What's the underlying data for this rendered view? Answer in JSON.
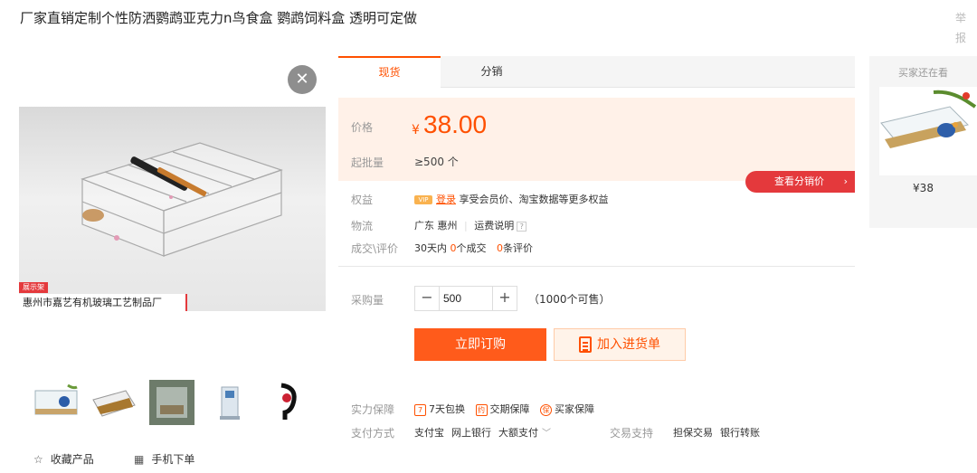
{
  "header": {
    "title": "厂家直销定制个性防洒鹦鹉亚克力n鸟食盒 鹦鹉饲料盒 透明可定做",
    "report": "举报"
  },
  "gallery": {
    "close_icon": "close-icon",
    "shop_tag_label": "展示架",
    "shop_name": "惠州市嘉艺有机玻璃工艺制品厂",
    "thumbnails": [
      "bird-feeder-photo",
      "feeder-with-seeds-photo",
      "feeder-closeup-photo",
      "small-feeder-photo",
      "bracket-photo"
    ],
    "favorite_label": "收藏产品",
    "mobile_order_label": "手机下单"
  },
  "tabs": [
    "现货",
    "分销"
  ],
  "price_panel": {
    "price_label": "价格",
    "currency": "¥",
    "price": "38.00",
    "moq_label": "起批量",
    "moq_value": "≥500 个",
    "distributor_price_button": "查看分销价",
    "chevron": "›"
  },
  "rights": {
    "label": "权益",
    "vip_badge": "VIP",
    "login_link": "登录",
    "text": "享受会员价、淘宝数据等更多权益"
  },
  "logistics": {
    "label": "物流",
    "origin": "广东 惠州",
    "freight_link": "运费说明",
    "help": "?"
  },
  "deals": {
    "label": "成交\\评价",
    "prefix": "30天内",
    "deal_count": "0",
    "deal_suffix": "个成交",
    "review_count": "0",
    "review_suffix": "条评价"
  },
  "quantity": {
    "label": "采购量",
    "minus": "−",
    "value": "500",
    "plus": "+",
    "available": "（1000个可售）"
  },
  "actions": {
    "order_now": "立即订购",
    "add_to_list": "加入进货单"
  },
  "guarantee": {
    "label": "实力保障",
    "items": [
      {
        "icon": "7",
        "text": "7天包换"
      },
      {
        "icon": "约",
        "text": "交期保障"
      },
      {
        "icon": "保",
        "text": "买家保障"
      }
    ]
  },
  "payment": {
    "label": "支付方式",
    "methods": [
      "支付宝",
      "网上银行",
      "大额支付"
    ],
    "dropdown": "﹀",
    "trade_label": "交易支持",
    "trade_methods": [
      "担保交易",
      "银行转账"
    ]
  },
  "rail": {
    "title": "买家还在看",
    "price": "¥38"
  },
  "colors": {
    "accent": "#ff5000",
    "red": "#e4393c",
    "price_bg": "#fff1e8"
  }
}
